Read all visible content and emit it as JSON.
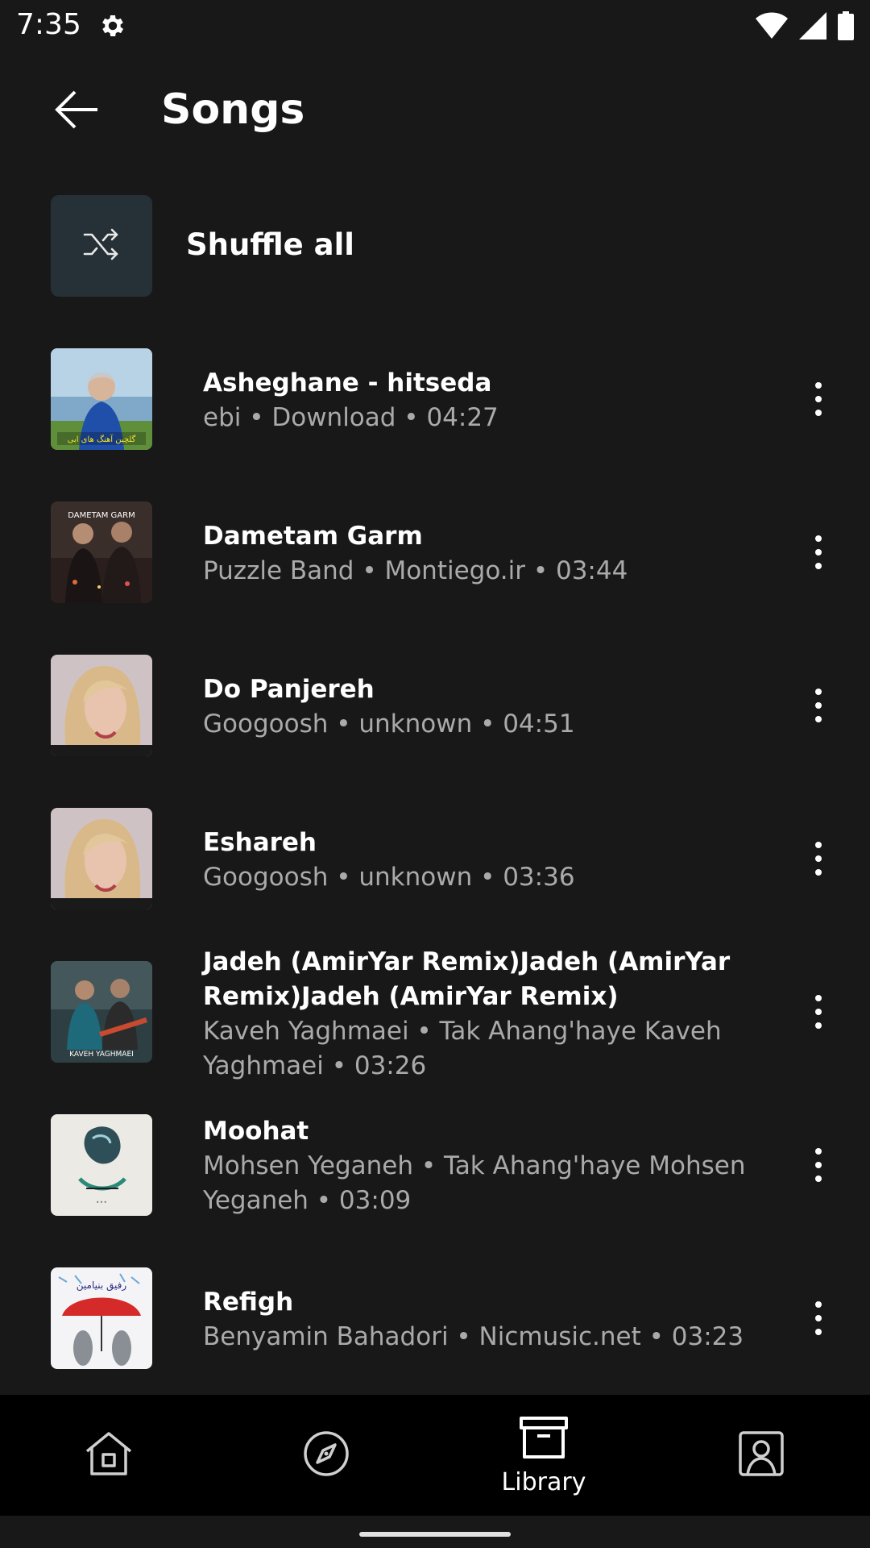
{
  "status_bar": {
    "time": "7:35",
    "icons": [
      "settings-icon",
      "wifi-icon",
      "cellular-signal-icon",
      "battery-icon"
    ]
  },
  "header": {
    "title": "Songs",
    "back_icon": "arrow-back-icon"
  },
  "shuffle": {
    "label": "Shuffle all",
    "icon": "shuffle-icon"
  },
  "songs": [
    {
      "title": "Asheghane - hitseda",
      "subtitle": "ebi • Download • 04:27",
      "thumb_caption": "گلچین آهنگ های ابی"
    },
    {
      "title": "Dametam Garm",
      "subtitle": "Puzzle Band • Montiego.ir  • 03:44",
      "thumb_caption": "DAMETAM GARM"
    },
    {
      "title": "Do Panjereh",
      "subtitle": "Googoosh • unknown • 04:51"
    },
    {
      "title": "Eshareh",
      "subtitle": "Googoosh • unknown • 03:36"
    },
    {
      "title_line1": "Jadeh (AmirYar Remix)Jadeh (AmirYar",
      "title_line2": "Remix)Jadeh (AmirYar Remix)",
      "subtitle_line1": "Kaveh Yaghmaei • Tak Ahang'haye Kaveh",
      "subtitle_line2": "Yaghmaei • 03:26",
      "thumb_caption": "KAVEH YAGHMAEI"
    },
    {
      "title": "Moohat",
      "subtitle_line1": "Mohsen Yeganeh • Tak Ahang'haye Mohsen",
      "subtitle_line2": "Yeganeh • 03:09"
    },
    {
      "title": "Refigh",
      "subtitle": "Benyamin Bahadori • Nicmusic.net • 03:23",
      "thumb_caption": "رفیق بنیامین"
    }
  ],
  "bottom_nav": {
    "items": [
      {
        "icon": "home-icon",
        "label": ""
      },
      {
        "icon": "explore-icon",
        "label": ""
      },
      {
        "icon": "library-icon",
        "label": "Library"
      },
      {
        "icon": "account-icon",
        "label": ""
      }
    ]
  },
  "colors": {
    "background": "#181818",
    "shuffle_tile": "#263037",
    "secondary_text": "#aaaaaa",
    "nav_background": "#000000"
  }
}
